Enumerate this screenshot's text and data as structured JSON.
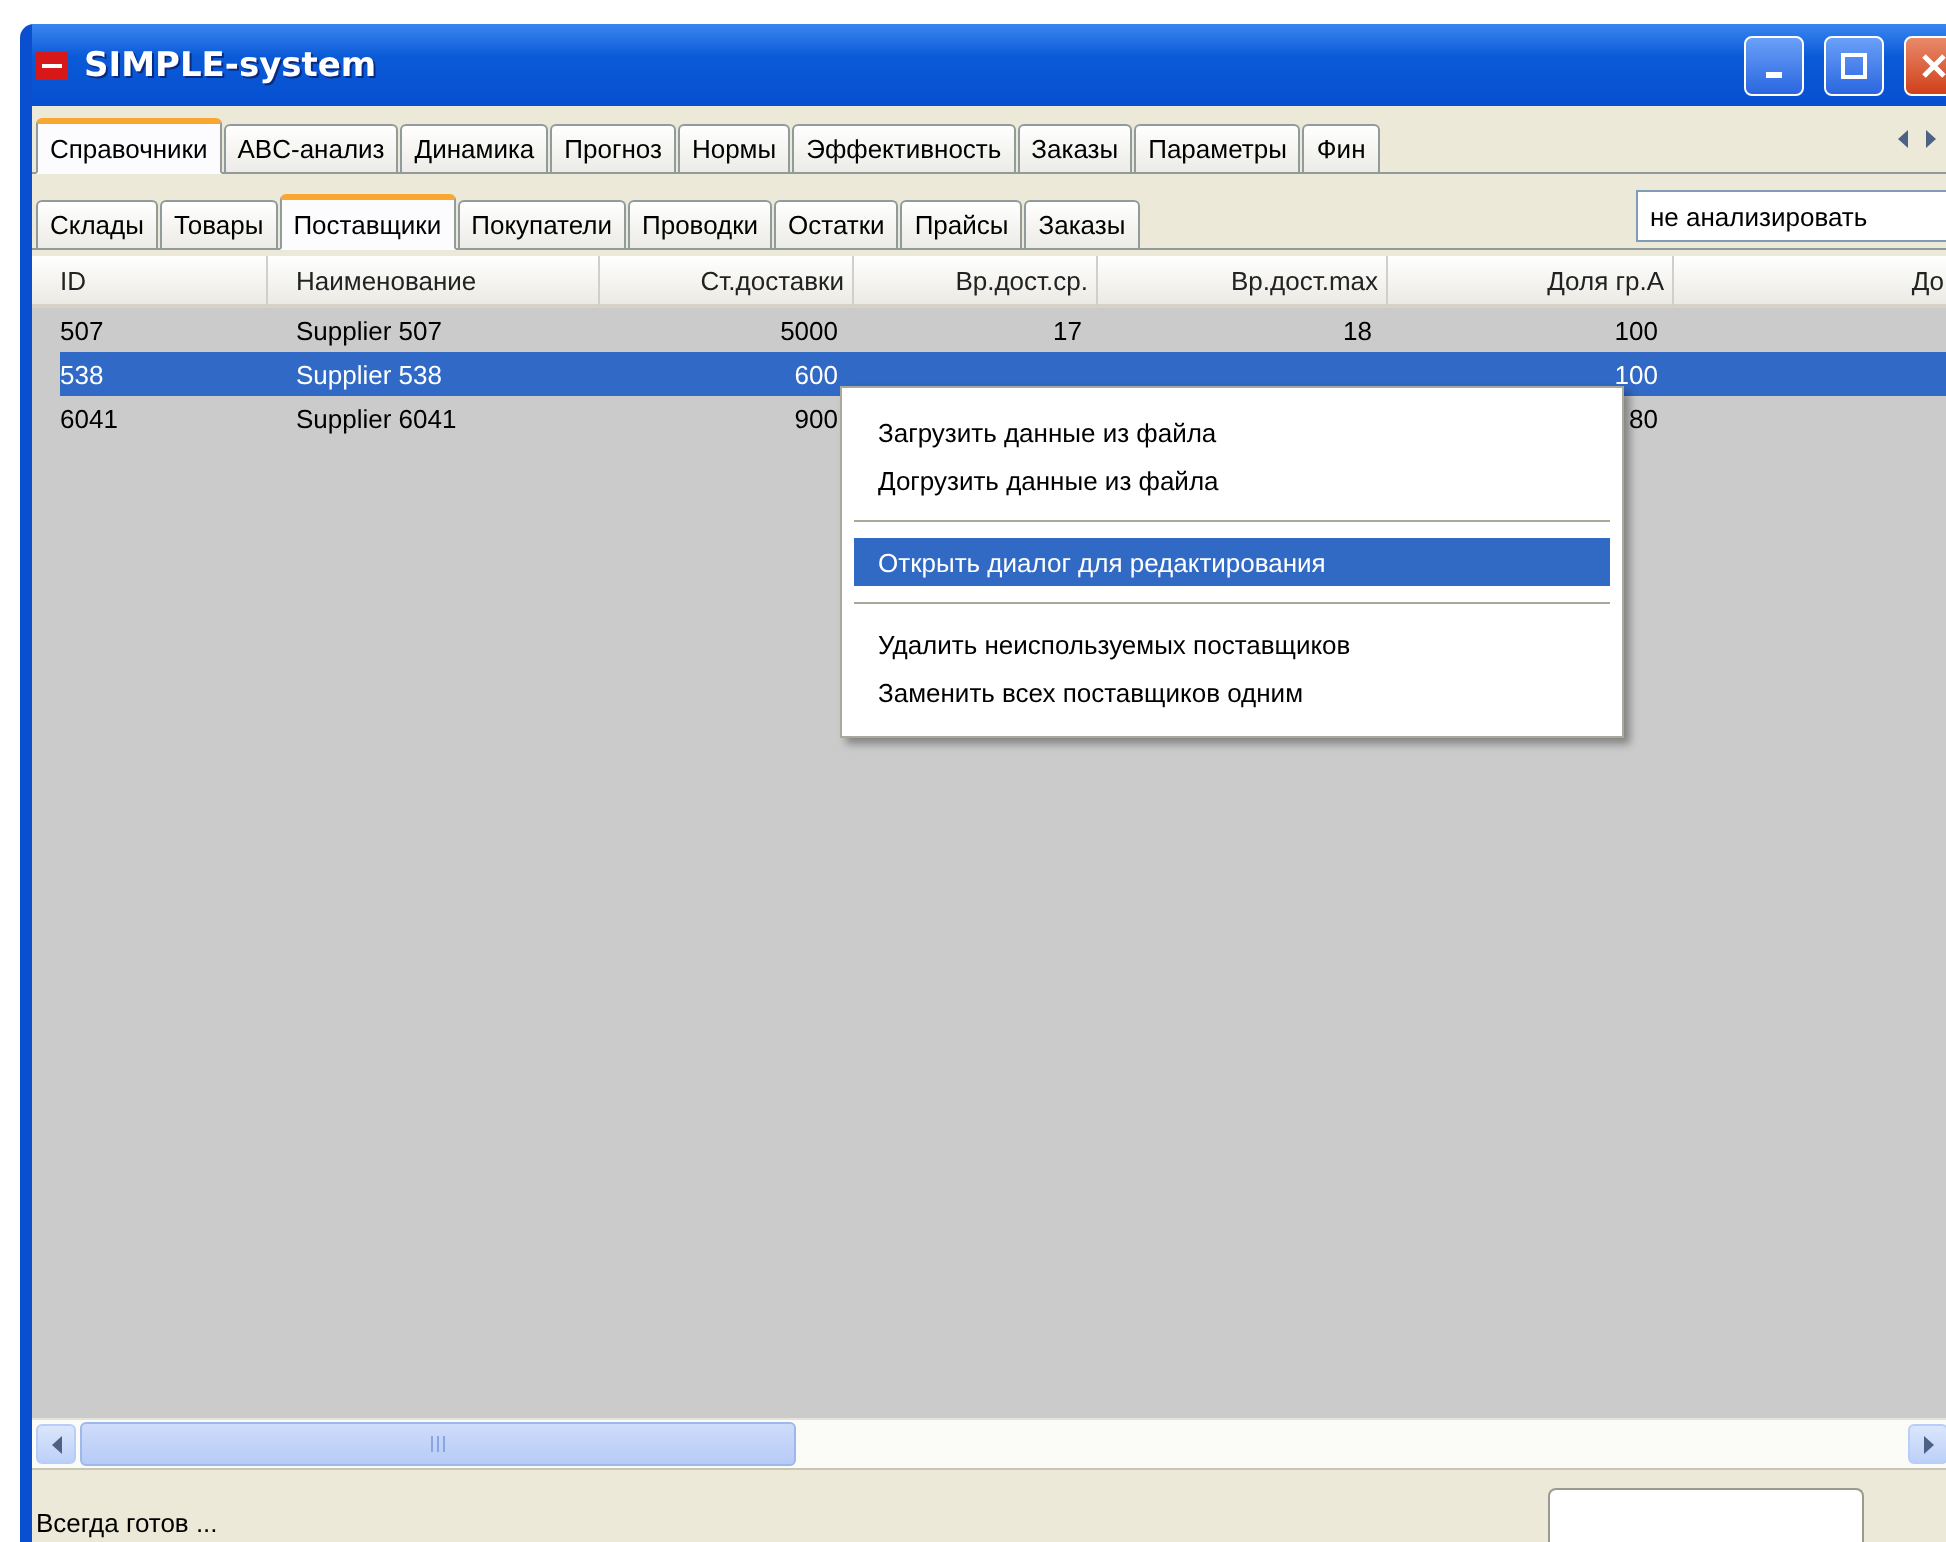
{
  "window": {
    "title": "SIMPLE-system"
  },
  "main_tabs": [
    {
      "label": "Справочники",
      "selected": true
    },
    {
      "label": "ABC-анализ",
      "selected": false
    },
    {
      "label": "Динамика",
      "selected": false
    },
    {
      "label": "Прогноз",
      "selected": false
    },
    {
      "label": "Нормы",
      "selected": false
    },
    {
      "label": "Эффективность",
      "selected": false
    },
    {
      "label": "Заказы",
      "selected": false
    },
    {
      "label": "Параметры",
      "selected": false
    },
    {
      "label": "Фин",
      "selected": false
    }
  ],
  "sub_tabs": [
    {
      "label": "Склады",
      "selected": false
    },
    {
      "label": "Товары",
      "selected": false
    },
    {
      "label": "Поставщики",
      "selected": true
    },
    {
      "label": "Покупатели",
      "selected": false
    },
    {
      "label": "Проводки",
      "selected": false
    },
    {
      "label": "Остатки",
      "selected": false
    },
    {
      "label": "Прайсы",
      "selected": false
    },
    {
      "label": "Заказы",
      "selected": false
    }
  ],
  "analysis_combo": {
    "value": "не анализировать"
  },
  "table": {
    "columns": [
      "ID",
      "Наименование",
      "Ст.доставки",
      "Вр.дост.ср.",
      "Вр.дост.max",
      "Доля гр.А",
      "До"
    ],
    "rows": [
      {
        "cells": [
          "507",
          "Supplier 507",
          "5000",
          "17",
          "18",
          "100"
        ],
        "selected": false
      },
      {
        "cells": [
          "538",
          "Supplier 538",
          "600",
          null,
          null,
          "100"
        ],
        "selected": true
      },
      {
        "cells": [
          "6041",
          "Supplier 6041",
          "900",
          null,
          null,
          "80"
        ],
        "selected": false
      }
    ]
  },
  "context_menu": [
    {
      "kind": "item",
      "label": "Загрузить данные из файла",
      "selected": false
    },
    {
      "kind": "item",
      "label": "Догрузить данные из файла",
      "selected": false
    },
    {
      "kind": "separator"
    },
    {
      "kind": "item",
      "label": "Открыть диалог для редактирования",
      "selected": true
    },
    {
      "kind": "separator"
    },
    {
      "kind": "item",
      "label": "Удалить неиспользуемых поставщиков",
      "selected": false
    },
    {
      "kind": "item",
      "label": "Заменить всех поставщиков одним",
      "selected": false
    }
  ],
  "status_bar": {
    "text": "Всегда готов ..."
  }
}
